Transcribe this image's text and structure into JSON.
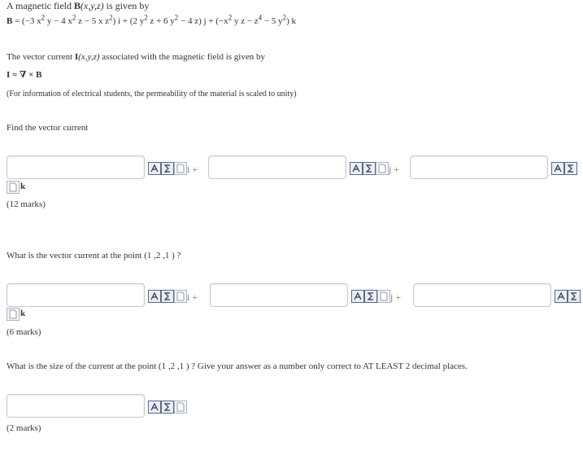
{
  "header": {
    "line1_prefix": "A magnetic field ",
    "line1_field": "B",
    "line1_args": "(x,y,z)",
    "line1_suffix": "  is given by",
    "b_lhs": "B",
    "b_eq": " = (−3 x",
    "b_t1": " y − 4 x",
    "b_t2": " z − 5 x z",
    "b_t3": ") i  +  (2 y",
    "b_t4": " z + 6 y",
    "b_t5": " − 4 z) j  +  (−x",
    "b_t6": " y z − z",
    "b_t7": " − 5 y",
    "b_t8": ") k",
    "sup2": "2",
    "sup4": "4"
  },
  "intro": {
    "sentence_prefix": "The vector current ",
    "sentence_field": "I",
    "sentence_args": "(x,y,z)",
    "sentence_suffix": " associated with the magnetic field is given by",
    "formula": "I = ∇ × B",
    "note": "(For information of electrical students, the permeability of the material is scaled to unity)"
  },
  "q1": {
    "prompt": "Find the vector current",
    "i_label": "i +",
    "j_label": "j +",
    "k_label": "k",
    "marks": "(12 marks)",
    "answers": [
      "",
      "",
      ""
    ]
  },
  "q2": {
    "prompt": "What is the vector current at the point (1 ,2 ,1 ) ?",
    "i_label": "i +",
    "j_label": "j +",
    "k_label": "k",
    "marks": "(6 marks)",
    "answers": [
      "",
      "",
      ""
    ]
  },
  "q3": {
    "prompt": "What is the size of the current at the point (1 ,2 ,1 ) ? Give your answer as a number only correct to AT LEAST 2 decimal places.",
    "marks": "(2 marks)",
    "answer": ""
  },
  "icons": {
    "preview": "formula-preview-icon",
    "sigma": "sigma-icon",
    "note": "page-icon"
  }
}
